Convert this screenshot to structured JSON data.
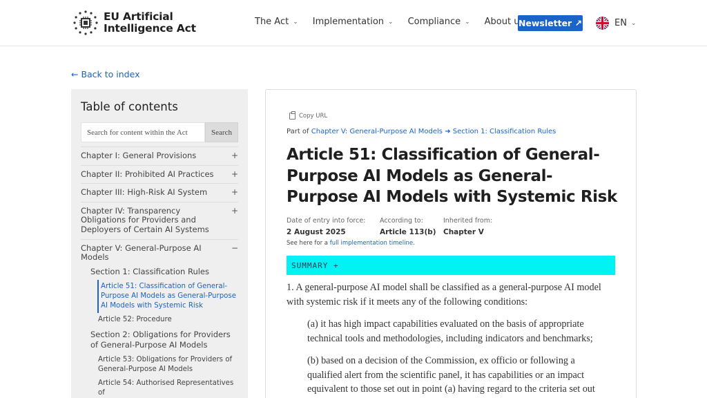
{
  "header": {
    "logo_line1": "EU Artificial",
    "logo_line2": "Intelligence Act",
    "nav": [
      {
        "label": "The Act",
        "has_caret": true
      },
      {
        "label": "Implementation",
        "has_caret": true
      },
      {
        "label": "Compliance",
        "has_caret": true
      },
      {
        "label": "About us",
        "has_caret": false
      }
    ],
    "newsletter_label": "Newsletter ↗",
    "language": "EN",
    "accent_color": "#1a63c7"
  },
  "back_link": "← Back to index",
  "sidebar": {
    "title": "Table of contents",
    "search_placeholder": "Search for content within the Act",
    "search_button": "Search",
    "chapters": [
      {
        "label": "Chapter I: General Provisions",
        "sign": "+"
      },
      {
        "label": "Chapter II: Prohibited AI Practices",
        "sign": "+"
      },
      {
        "label": "Chapter III: High-Risk AI System",
        "sign": "+"
      },
      {
        "label": "Chapter IV: Transparency Obligations for Providers and Deployers of Certain AI Systems",
        "sign": "+"
      },
      {
        "label": "Chapter V: General-Purpose AI Models",
        "sign": "−"
      }
    ],
    "sub_items": [
      {
        "kind": "section",
        "label": "Section 1: Classification Rules"
      },
      {
        "kind": "article-active",
        "label": "Article 51: Classification of General-Purpose AI Models as General-Purpose AI Models with Systemic Risk"
      },
      {
        "kind": "article",
        "label": "Article 52: Procedure"
      },
      {
        "kind": "section",
        "label": "Section 2: Obligations for Providers of General-Purpose AI Models"
      },
      {
        "kind": "article",
        "label": "Article 53: Obligations for Providers of General-Purpose AI Models"
      },
      {
        "kind": "article",
        "label": "Article 54: Authorised Representatives of"
      }
    ]
  },
  "article": {
    "copy_url": "Copy URL",
    "part_of_prefix": "Part of",
    "part_of_chapter": "Chapter V: General-Purpose AI Models",
    "part_of_arrow": "➜",
    "part_of_section": "Section 1: Classification Rules",
    "title": "Article 51: Classification of General-Purpose AI Models as General-Purpose AI Models with Systemic Risk",
    "meta": [
      {
        "label": "Date of entry into force:",
        "value": "2 August 2025"
      },
      {
        "label": "According to:",
        "value": "Article 113(b)"
      },
      {
        "label": "Inherited from:",
        "value": "Chapter V"
      }
    ],
    "timeline_prefix": "See here for a",
    "timeline_link": "full implementation timeline",
    "timeline_suffix": ".",
    "summary_label": "SUMMARY +",
    "summary_color": "#00f2f2",
    "paragraphs": [
      {
        "indent": false,
        "text": "1. A general-purpose AI model shall be classified as a general-purpose AI model with systemic risk if it meets any of the following conditions:"
      },
      {
        "indent": true,
        "text": "(a) it has high impact capabilities evaluated on the basis of appropriate technical tools and methodologies, including indicators and benchmarks;"
      },
      {
        "indent": true,
        "text": "(b) based on a decision of the Commission, ex officio or following a qualified alert from the scientific panel, it has capabilities or an impact equivalent to those set out in point (a) having regard to the criteria set out"
      }
    ]
  }
}
